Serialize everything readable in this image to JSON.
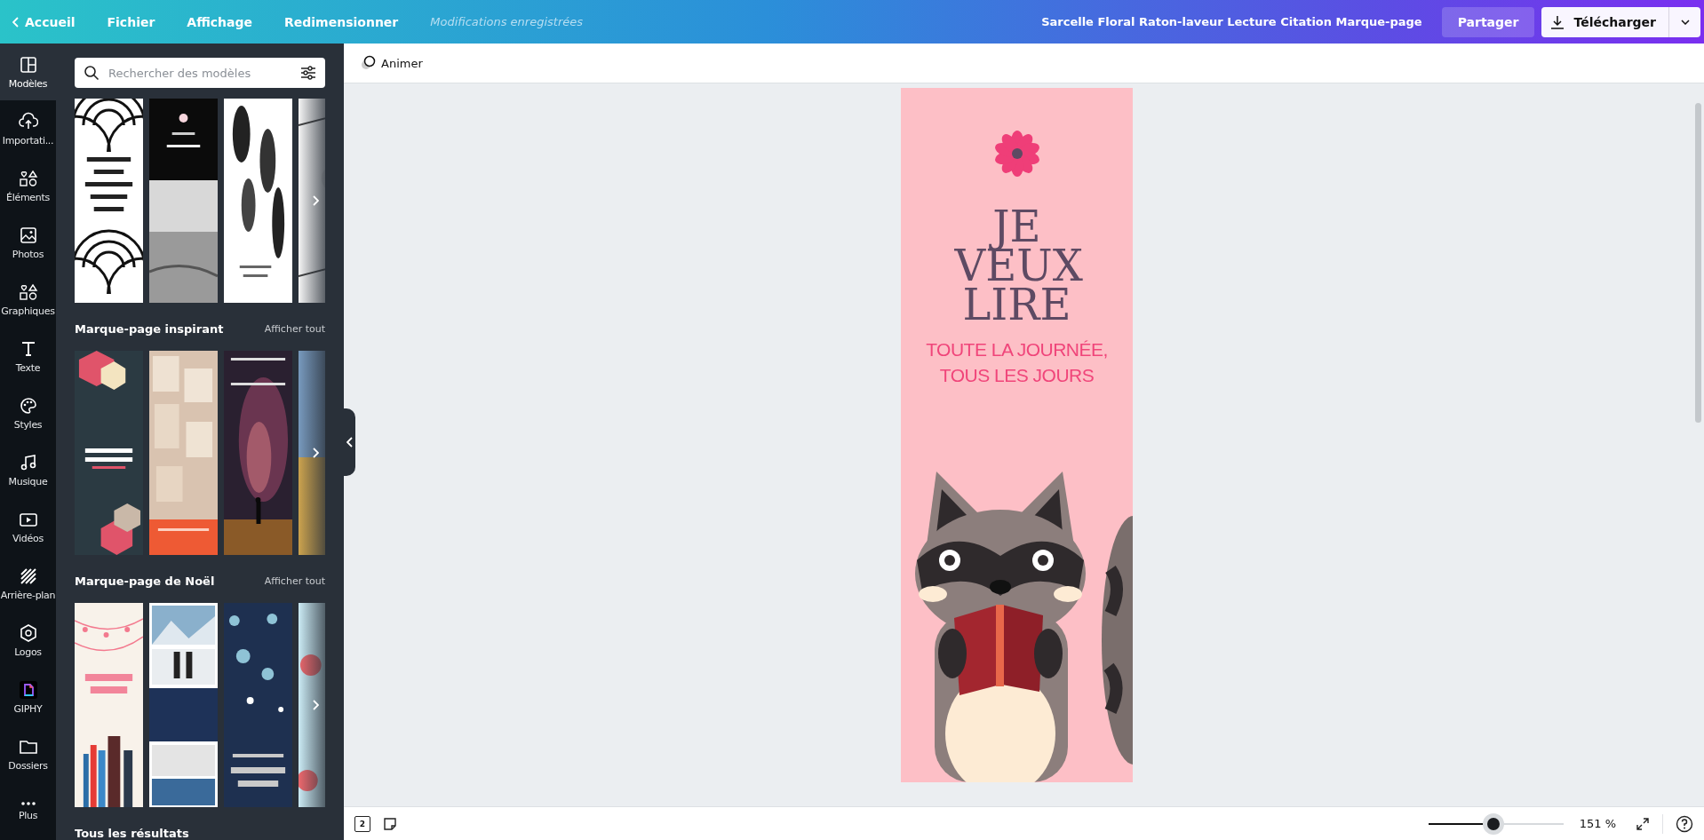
{
  "topbar": {
    "back": "Accueil",
    "menu": [
      {
        "label": "Fichier"
      },
      {
        "label": "Affichage"
      },
      {
        "label": "Redimensionner"
      }
    ],
    "save_status": "Modifications enregistrées",
    "document_title": "Sarcelle Floral Raton-laveur Lecture Citation Marque-page",
    "share_button": "Partager",
    "download_button": "Télécharger"
  },
  "rail": [
    {
      "label": "Modèles",
      "selected": true
    },
    {
      "label": "Importati...",
      "selected": false
    },
    {
      "label": "Éléments",
      "selected": false
    },
    {
      "label": "Photos",
      "selected": false
    },
    {
      "label": "Graphiques",
      "selected": false
    },
    {
      "label": "Texte",
      "selected": false
    },
    {
      "label": "Styles",
      "selected": false
    },
    {
      "label": "Musique",
      "selected": false
    },
    {
      "label": "Vidéos",
      "selected": false
    },
    {
      "label": "Arrière-plan",
      "selected": false
    },
    {
      "label": "Logos",
      "selected": false
    },
    {
      "label": "GIPHY",
      "selected": false
    },
    {
      "label": "Dossiers",
      "selected": false
    },
    {
      "label": "Plus",
      "selected": false
    }
  ],
  "panel": {
    "search": {
      "placeholder": "Rechercher des modèles"
    },
    "sections": [
      {
        "templates": [
          {
            "kind": "picture"
          },
          {
            "kind": "picture"
          },
          {
            "kind": "picture"
          },
          {
            "kind": "picture"
          }
        ]
      },
      {
        "title": "Marque-page inspirant",
        "see_all": "Afficher tout",
        "templates": [
          {
            "kind": "picture"
          },
          {
            "kind": "picture"
          },
          {
            "kind": "picture"
          },
          {
            "kind": "picture"
          }
        ]
      },
      {
        "title": "Marque-page de Noël",
        "see_all": "Afficher tout",
        "templates": [
          {
            "kind": "picture"
          },
          {
            "kind": "picture"
          },
          {
            "kind": "picture"
          },
          {
            "kind": "picture"
          }
        ]
      },
      {
        "title": "Tous les résultats"
      }
    ]
  },
  "toolbar": {
    "animate_button": "Animer"
  },
  "design": {
    "title": "JE VEUX LIRE",
    "subtitle": "TOUTE LA JOURNÉE, TOUS LES JOURS"
  },
  "bottombar": {
    "page_count": "2",
    "zoom": {
      "level": 0.48,
      "reading": "151 %"
    }
  }
}
